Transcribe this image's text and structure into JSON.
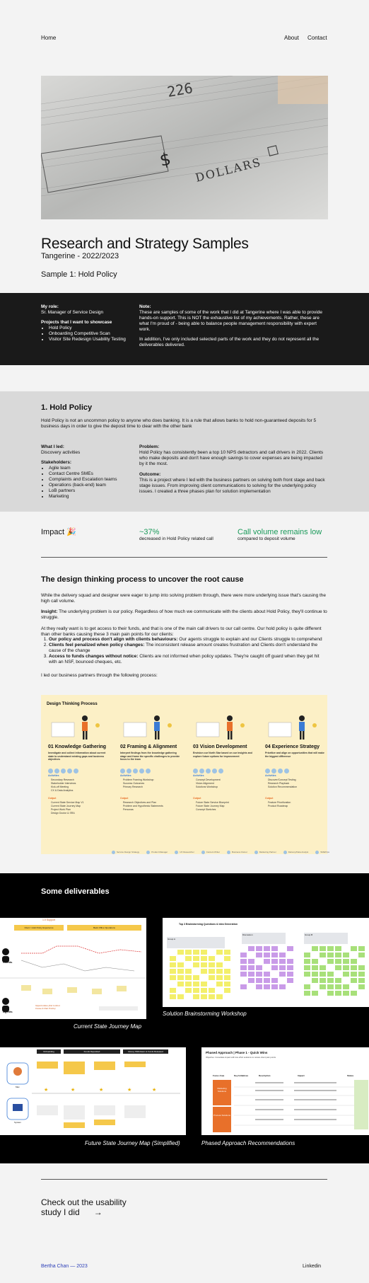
{
  "nav": {
    "home": "Home",
    "about": "About",
    "contact": "Contact"
  },
  "page": {
    "title": "Research and Strategy Samples",
    "subtitle": "Tangerine - 2022/2023",
    "sample_heading": "Sample 1: Hold Policy"
  },
  "role": {
    "role_label": "My role:",
    "role_value": "Sr. Manager of Service Design",
    "projects_label": "Projects that I want to showcase",
    "projects": [
      "Hold Policy",
      "Onboarding Competitive Scan",
      "Visitor Site Redesign Usability Testing"
    ],
    "note_label": "Note:",
    "note_p1": "These are samples of some of the work that I did at Tangerine where I was able to provide hands-on support. This is NOT the exhaustive list of my achievements. Rather, these are what I'm proud of - being able to balance people management responsibility with expert work.",
    "note_p2": "In addition, I've only included selected parts of the work and they do not represent all the deliverables delivered."
  },
  "hold": {
    "heading": "1. Hold Policy",
    "intro": "Hold Policy is not an uncommon policy to anyone who does banking. It is a rule that allows banks to hold non-guaranteed deposits for 5 business days in order to give the deposit time to clear with the other bank",
    "led_label": "What I led:",
    "led_value": "Discovery activities",
    "stakeholders_label": "Stakeholders:",
    "stakeholders": [
      "Agile team",
      "Contact Centre SMEs",
      "Complaints and Escalation teams",
      "Operations (back-end) team",
      "LoB partners",
      "Marketing"
    ],
    "problem_label": "Problem:",
    "problem_text": "Hold Policy has consistently been a top 10 NPS detractors and call drivers in 2022. Clients who make deposits and don't have enough savings to cover expenses are being impacted by it the most.",
    "outcome_label": "Outcome:",
    "outcome_text": "This is a project where I led with the business partners on solving both front stage and back stage issues. From improving client communications to solving for the underlying policy issues. I created a three phases plan for solution implementation"
  },
  "impact": {
    "label": "Impact",
    "emoji": "🎉",
    "metric1_value": "~37%",
    "metric1_desc": "decreased in Hold Policy related call",
    "metric2_value": "Call volume remains low",
    "metric2_desc": "compared to deposit volume"
  },
  "design": {
    "heading": "The design thinking process to uncover the root cause",
    "p1": "While the delivery squad and designer were eager to jump into solving problem through, there were more underlying issue that's causing the high call volume.",
    "insight_label": "Insight:",
    "insight_text": " The underlying problem is our policy. Regardless of how much we communicate with the clients about Hold Policy, they'll continue to struggle.",
    "p3": "At they really want is to get access to their funds, and that is one of the main call drivers to our call centre. Our hold policy is quite different than other banks causing these 3 main pain points for our clients:",
    "points": [
      {
        "bold": "Our policy and process don't align with clients behaviours:",
        "text": " Our agents struggle to explain and our Clients struggle to comprehend"
      },
      {
        "bold": "Clients feel penalized when policy changes:",
        "text": " The inconsistent release amount creates frustration and Clients don't understand the cause of the change"
      },
      {
        "bold": "Access to funds changes without notice:",
        "text": " Clients are not informed when policy updates. They're caught off guard when they get hit with an NSF, bounced cheques, etc."
      }
    ],
    "closing": "I led our business partners through the following process:"
  },
  "process": {
    "title": "Design Thinking Process",
    "steps": [
      {
        "title": "01 Knowledge Gathering",
        "desc": "Investigate and collect information about current state to understand existing gaps and business objectives",
        "activities": [
          "Secondary Research",
          "Stakeholder Interviews",
          "Kick-off Meeting",
          "CX & Data Analytics"
        ],
        "outputs": [
          "Current State Service Map V1",
          "Current State Journey Map",
          "Project Work Plan",
          "Design Doctor & SRA"
        ]
      },
      {
        "title": "02 Framing & Alignment",
        "desc": "Interpret findings from the knowledge gathering stage and frame the specific challenges to provide focus to the team",
        "activities": [
          "Problem Framing Workshop",
          "Success Outcomes",
          "Primary Research"
        ],
        "outputs": [
          "Research Objectives and Plan",
          "Problem and Hypothesis Statements",
          "Personas"
        ]
      },
      {
        "title": "03 Vision Development",
        "desc": "Envision our North Star based on our insights and explore future options for improvement",
        "activities": [
          "Concept Development",
          "Vision Alignment",
          "Solutions Workshop"
        ],
        "outputs": [
          "Future State Service Blueprint",
          "Future State Journey Map",
          "Concept Sketches"
        ]
      },
      {
        "title": "04 Experience Strategy",
        "desc": "Prioritize and align on opportunities that will make the biggest difference",
        "activities": [
          "Discover/Concept Testing",
          "Research Playback",
          "Solution Recommendation"
        ],
        "outputs": [
          "Feature Prioritization",
          "Product Roadmap"
        ]
      }
    ],
    "activities_label": "Activities",
    "output_label": "Output",
    "legend": [
      "Service Design Strategy",
      "Product Manager",
      "UX Researcher",
      "Content Writer",
      "Business Owner",
      "Marketing Partner",
      "Delivery/Data Analyst",
      "SME/Ops"
    ]
  },
  "deliverables": {
    "heading": "Some deliverables",
    "items": [
      {
        "caption": "Current State Journey Map"
      },
      {
        "caption": "Solution Brainstorming Workshop"
      },
      {
        "caption": "Future State Journey Map (Simplified)"
      },
      {
        "caption": "Phased Approach Recommendations"
      }
    ],
    "thumb1": {
      "top_label": "1.0 Support",
      "lane1": "Client / Hold Policy Experience",
      "lane2": "Back Office Operations",
      "persona1": "Clients",
      "persona2": "Agents",
      "note": "Opportunities (link to Root Cause & Pain Points)"
    },
    "thumb2": {
      "title": "Top 3 Brainstorming Questions & Idea Generation",
      "col1": "Group A",
      "col2": "Discussion",
      "col3": "Group B"
    },
    "thumb3": {
      "headers": [
        "Onboarding",
        "Funds Deposited",
        "Money Withdrawn & Funds Released"
      ],
      "persona1": "Max",
      "persona2": "System"
    },
    "thumb4": {
      "title": "Phased Approach | Phase 1 - Quick Wins",
      "subtitle": "Objective: Immediate impact with low effort solutions to reduce client pain points",
      "phase1": "Marketing Solutions",
      "phase2": "Process Solutions",
      "cols": [
        "Focus Area",
        "Key Initiatives",
        "Description",
        "Impact",
        "Status"
      ]
    }
  },
  "cta": {
    "line1": "Check out the usability",
    "line2": "study I did",
    "arrow": "→"
  },
  "footer": {
    "left": "Bertha Chan — 2023",
    "right": "Linkedin"
  },
  "colors": {
    "accent_green": "#1a9a5a",
    "accent_blue": "#2c3fb8",
    "process_bg": "#fcf0c6",
    "dark_band": "#1a1a1a"
  }
}
